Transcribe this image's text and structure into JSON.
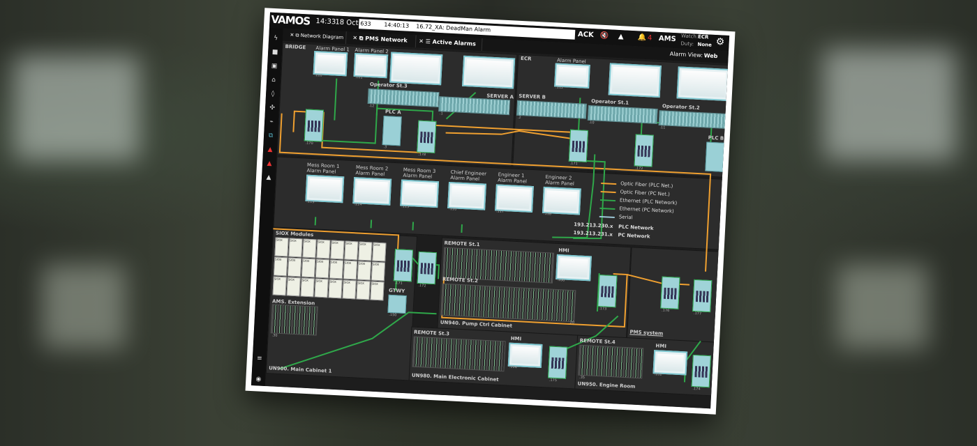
{
  "header": {
    "logo": "VAMOS",
    "time": "14:33",
    "date": "18 Oct",
    "alarm_id": "633",
    "alarm_time": "14:40:13",
    "alarm_text": "16.72_XA: DeadMan Alarm",
    "ack_label": "ACK",
    "alarm_count": "4",
    "ams_label": "AMS",
    "watch_label": "Watch:",
    "watch_value": "ECR",
    "duty_label": "Duty:",
    "duty_value": "None"
  },
  "tabs": [
    {
      "label": "Network Diagram"
    },
    {
      "label": "PMS Network Dia"
    },
    {
      "label": "Active Alarms"
    }
  ],
  "view": {
    "alarm_view_label": "Alarm View:",
    "alarm_view_value": "Web"
  },
  "zones": {
    "bridge": "BRIDGE",
    "ecr": "ECR",
    "siox": "SIOX Modules",
    "ams_ext": "AMS. Extension",
    "un900": "UN900. Main Cabinet 1",
    "un940": "UN940. Pump Ctrl Cabinet",
    "un980": "UN980. Main Electronic Cabinet",
    "un950": "UN950. Engine Room",
    "pms": "PMS system"
  },
  "labels": {
    "alarm_panel_1": "Alarm Panel 1",
    "alarm_panel_2": "Alarm Panel 2",
    "alarm_panel": "Alarm Panel",
    "operator_st3": "Operator St.3",
    "operator_st1": "Operator St.1",
    "operator_st2": "Operator St.2",
    "server_a": "SERVER A",
    "server_b": "SERVER B",
    "plc_a": "PLC A",
    "plc_b": "PLC B",
    "mess1": "Mess Room 1",
    "mess2": "Mess Room 2",
    "mess3": "Mess Room 3",
    "chief": "Chief Engineer",
    "eng1": "Engineer 1",
    "eng2": "Engineer 2",
    "remote1": "REMOTE St.1",
    "remote2": "REMOTE St.2",
    "remote3": "REMOTE St.3",
    "remote4": "REMOTE St.4",
    "hmi": "HMI",
    "gtwy": "GTWY"
  },
  "legend": [
    {
      "label": "Optic Fiber (PLC Net.)",
      "color": "#f0a030"
    },
    {
      "label": "Optic Fiber (PC Net.)",
      "color": "#f0a030"
    },
    {
      "label": "Ethernet (PLC Network)",
      "color": "#2fa84a"
    },
    {
      "label": "Ethernet (PC Network)",
      "color": "#2fa84a"
    },
    {
      "label": "Serial",
      "color": "#9cc7d6"
    }
  ],
  "networks": [
    {
      "ip": "193.213.230.x",
      "name": "PLC Network"
    },
    {
      "ip": "193.213.231.x",
      "name": "PC Network"
    }
  ],
  "nums": {
    "n110": ".110",
    "n111": ".111",
    "n12": ".12",
    "n1": ".1",
    "n2": ".2",
    "n3": ".3",
    "n170": ".170",
    "n178": ".178",
    "n112": ".112",
    "n10": ".10",
    "n11": ".11",
    "n171": ".171",
    "n172": ".172",
    "n113": ".113",
    "n114": ".114",
    "n115": ".115",
    "n116": ".116",
    "n117": ".117",
    "n118": ".118",
    "n150": ".150",
    "n106": ".106",
    "n173": ".173",
    "n176": ".176",
    "n177": ".177",
    "n104": ".104",
    "n175": ".175",
    "n102": ".102",
    "n174": ".174",
    "n20": ".20",
    "n30": ".30",
    "n35": ".35"
  },
  "siox_label": "SIOX",
  "colors": {
    "fiber": "#f0a030",
    "ethernet": "#2fa84a",
    "serial": "#9cc7d6"
  }
}
